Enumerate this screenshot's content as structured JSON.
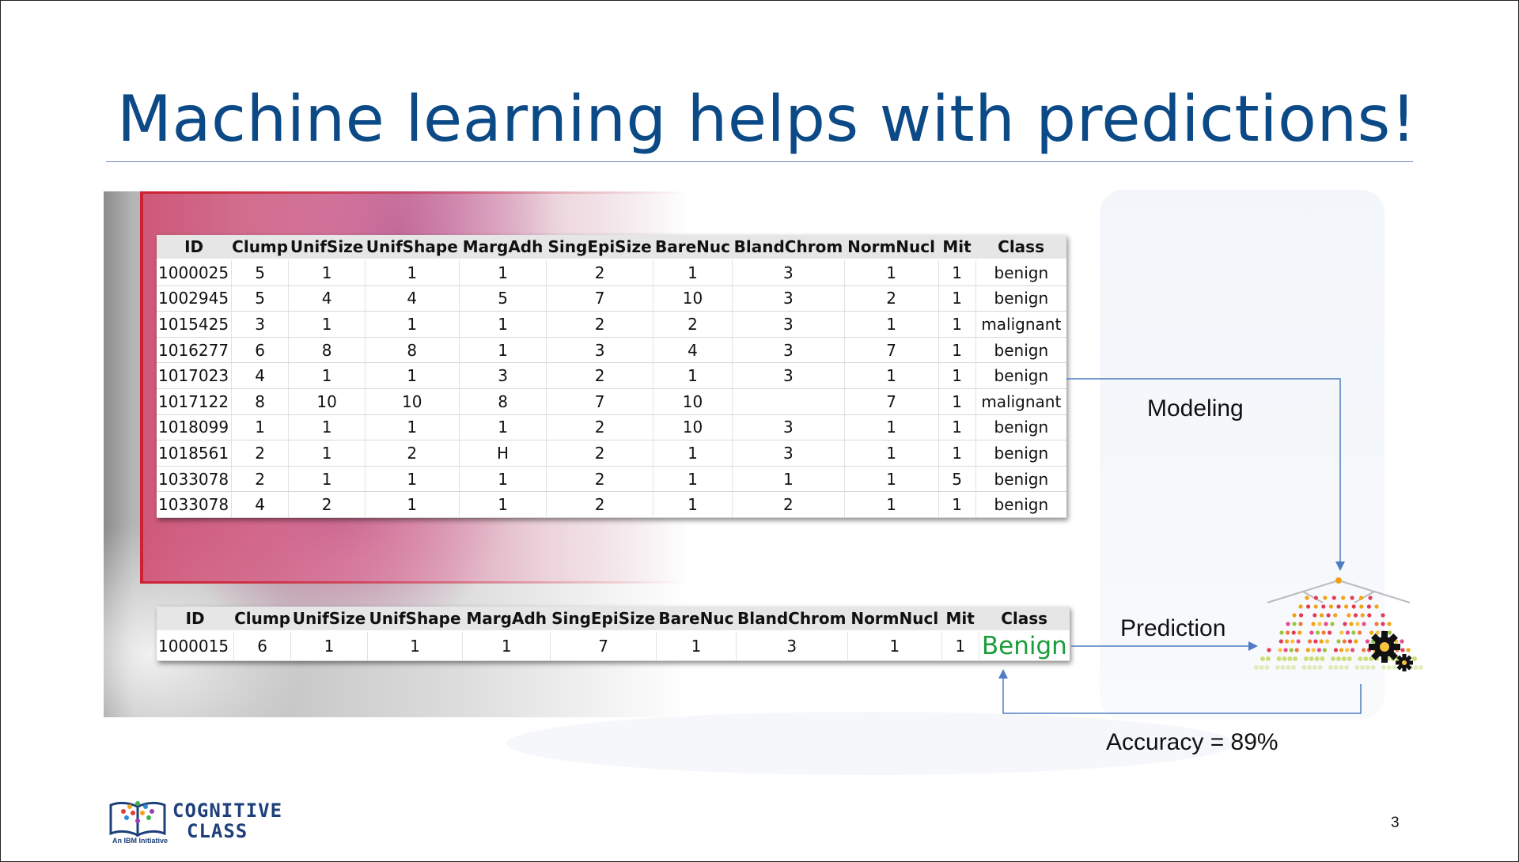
{
  "slide": {
    "title": "Machine learning helps with predictions!",
    "page_number": "3"
  },
  "main_table": {
    "headers": [
      "ID",
      "Clump",
      "UnifSize",
      "UnifShape",
      "MargAdh",
      "SingEpiSize",
      "BareNuc",
      "BlandChrom",
      "NormNucl",
      "Mit",
      "Class"
    ],
    "rows": [
      [
        "1000025",
        "5",
        "1",
        "1",
        "1",
        "2",
        "1",
        "3",
        "1",
        "1",
        "benign"
      ],
      [
        "1002945",
        "5",
        "4",
        "4",
        "5",
        "7",
        "10",
        "3",
        "2",
        "1",
        "benign"
      ],
      [
        "1015425",
        "3",
        "1",
        "1",
        "1",
        "2",
        "2",
        "3",
        "1",
        "1",
        "malignant"
      ],
      [
        "1016277",
        "6",
        "8",
        "8",
        "1",
        "3",
        "4",
        "3",
        "7",
        "1",
        "benign"
      ],
      [
        "1017023",
        "4",
        "1",
        "1",
        "3",
        "2",
        "1",
        "3",
        "1",
        "1",
        "benign"
      ],
      [
        "1017122",
        "8",
        "10",
        "10",
        "8",
        "7",
        "10",
        "",
        "7",
        "1",
        "malignant"
      ],
      [
        "1018099",
        "1",
        "1",
        "1",
        "1",
        "2",
        "10",
        "3",
        "1",
        "1",
        "benign"
      ],
      [
        "1018561",
        "2",
        "1",
        "2",
        "H",
        "2",
        "1",
        "3",
        "1",
        "1",
        "benign"
      ],
      [
        "1033078",
        "2",
        "1",
        "1",
        "1",
        "2",
        "1",
        "1",
        "1",
        "5",
        "benign"
      ],
      [
        "1033078",
        "4",
        "2",
        "1",
        "1",
        "2",
        "1",
        "2",
        "1",
        "1",
        "benign"
      ]
    ]
  },
  "prediction_table": {
    "headers": [
      "ID",
      "Clump",
      "UnifSize",
      "UnifShape",
      "MargAdh",
      "SingEpiSize",
      "BareNuc",
      "BlandChrom",
      "NormNucl",
      "Mit",
      "Class"
    ],
    "rows": [
      [
        "1000015",
        "6",
        "1",
        "1",
        "1",
        "7",
        "1",
        "3",
        "1",
        "1",
        "Benign"
      ]
    ]
  },
  "labels": {
    "modeling": "Modeling",
    "prediction": "Prediction",
    "accuracy": "Accuracy = 89%"
  },
  "logo": {
    "line1": "COGNITIVE",
    "line2": "CLASS",
    "tagline": "An IBM Initiative"
  },
  "colors": {
    "title": "#0b4a86",
    "arrow": "#4f7cc4",
    "predicted_class": "#1a9c3a"
  }
}
